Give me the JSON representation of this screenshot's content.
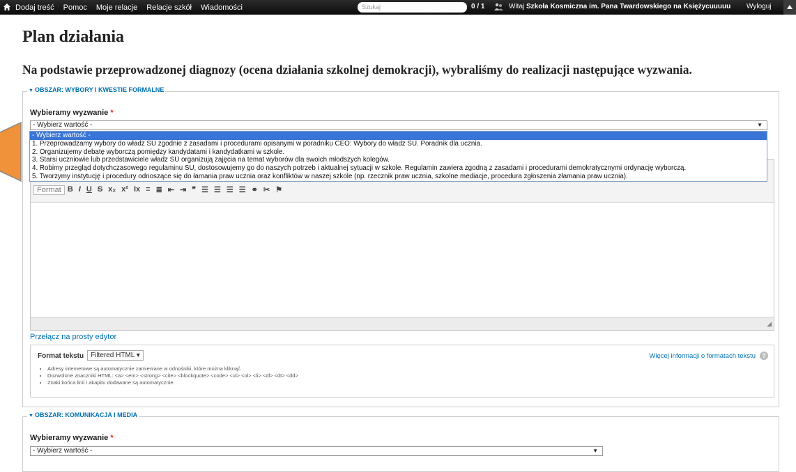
{
  "topbar": {
    "nav": [
      "Dodaj treść",
      "Pomoc",
      "Moje relacje",
      "Relacje szkół",
      "Wiadomości"
    ],
    "search_placeholder": "Szukaj",
    "counter": "0 / 1",
    "welcome_prefix": "Witaj",
    "welcome_name": "Szkoła Kosmiczna im. Pana Twardowskiego na Księżycuuuuu",
    "logout": "Wyloguj"
  },
  "page": {
    "title": "Plan działania",
    "subtitle": "Na podstawie przeprowadzonej diagnozy (ocena działania szkolnej demokracji), wybraliśmy do realizacji następujące wyzwania."
  },
  "areas": [
    {
      "legend": "OBSZAR: WYBORY I KWESTIE FORMALNE",
      "field_label": "Wybieramy wyzwanie",
      "required_mark": "*",
      "selected": "- Wybierz wartość -",
      "options": [
        "- Wybierz wartość -",
        "1. Przeprowadzamy wybory do władz SU zgodnie z zasadami i procedurami opisanymi w poradniku CEO: Wybory do władz SU. Poradnik dla ucznia.",
        "2. Organizujemy debatę wyborczą pomiędzy kandydatami i kandydatkami w szkole.",
        "3. Starsi uczniowie lub przedstawiciele władz SU organizują zajęcia na temat wyborów dla swoich młodszych kolegów.",
        "4. Robimy przegląd dotychczasowego regulaminu SU, dostosowujemy go do naszych potrzeb i aktualnej sytuacji w szkole. Regulamin zawiera zgodną z zasadami i procedurami demokratycznymi ordynację wyborczą.",
        "5. Tworzymy instytucję i procedury odnoszące się do łamania praw ucznia oraz konfliktów w naszej szkole (np. rzecznik praw ucznia, szkolne mediacje, procedura zgłoszenia złamania praw ucznia)."
      ],
      "editor": {
        "format_dropdown": "Format",
        "switch_link": "Przełącz na prosty edytor",
        "format_label": "Format tekstu",
        "format_value": "Filtered HTML",
        "more_info": "Więcej informacji o formatach tekstu",
        "tips": [
          "Adresy internetowe są automatycznie zamieniane w odnośniki, które można kliknąć.",
          "Dozwolone znaczniki HTML: <a> <em> <strong> <cite> <blockquote> <code> <ul> <ol> <li> <dl> <dt> <dd>",
          "Znaki końca linii i akapitu dodawane są automatycznie."
        ]
      }
    },
    {
      "legend": "OBSZAR: KOMUNIKACJA I MEDIA",
      "field_label": "Wybieramy wyzwanie",
      "required_mark": "*",
      "selected": "- Wybierz wartość -"
    }
  ],
  "colors": {
    "link": "#0071b3",
    "required": "#e32700",
    "selection": "#3875d7",
    "arrow": "#f0923a"
  }
}
